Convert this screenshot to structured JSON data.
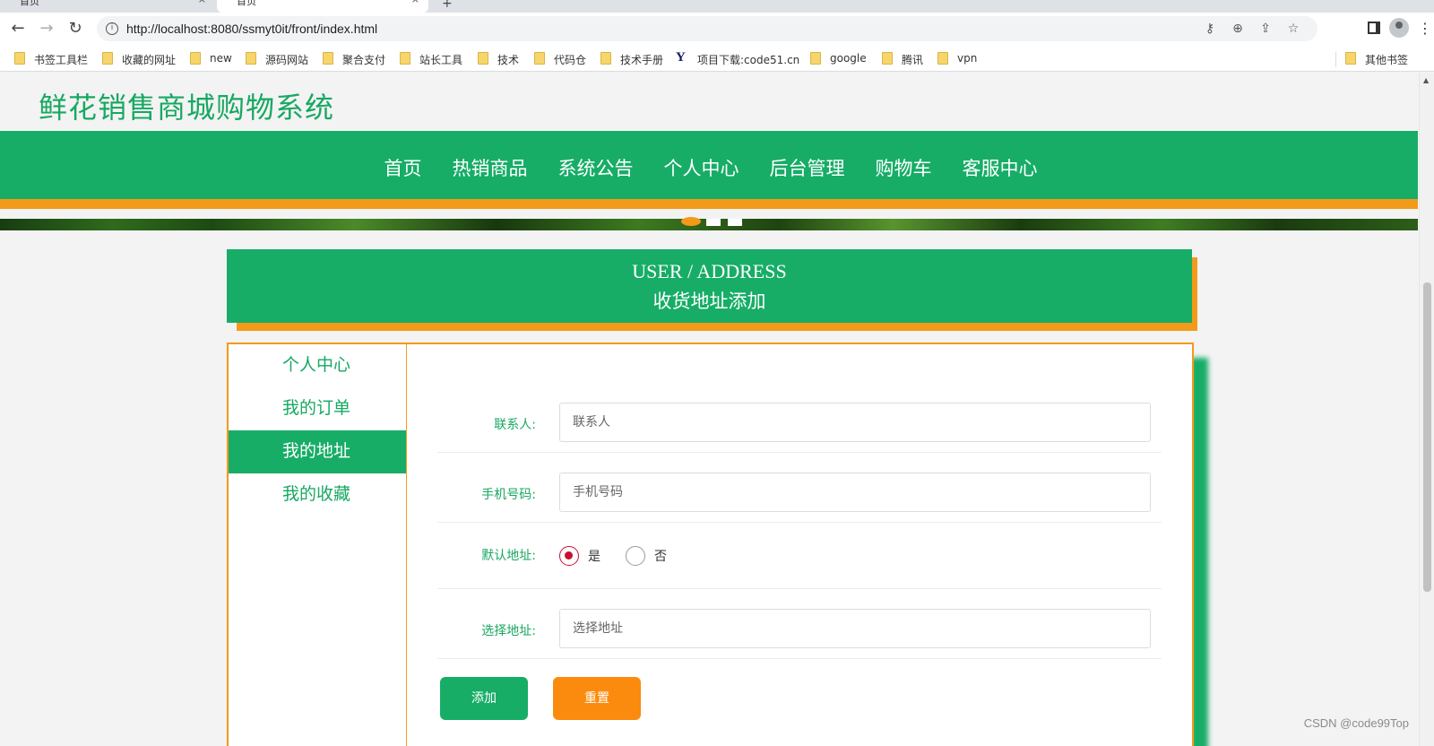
{
  "browser": {
    "tabs": [
      {
        "title": "首页"
      },
      {
        "title": "首页"
      }
    ],
    "new_tab": "+",
    "url": "http://localhost:8080/ssmyt0it/front/index.html",
    "bookmarks": [
      {
        "label": "书签工具栏",
        "icon": "folder-icon"
      },
      {
        "label": "收藏的网址",
        "icon": "folder-icon"
      },
      {
        "label": "new",
        "icon": "folder-icon"
      },
      {
        "label": "源码网站",
        "icon": "folder-icon"
      },
      {
        "label": "聚合支付",
        "icon": "folder-icon"
      },
      {
        "label": "站长工具",
        "icon": "folder-icon"
      },
      {
        "label": "技术",
        "icon": "folder-icon"
      },
      {
        "label": "代码仓",
        "icon": "folder-icon"
      },
      {
        "label": "技术手册",
        "icon": "folder-icon"
      },
      {
        "label": "项目下载:code51.cn",
        "icon": "y-logo-icon"
      },
      {
        "label": "google",
        "icon": "folder-icon"
      },
      {
        "label": "腾讯",
        "icon": "folder-icon"
      },
      {
        "label": "vpn",
        "icon": "folder-icon"
      },
      {
        "label": "其他书签",
        "icon": "folder-icon"
      }
    ]
  },
  "site": {
    "title": "鲜花销售商城购物系统",
    "nav": [
      "首页",
      "热销商品",
      "系统公告",
      "个人中心",
      "后台管理",
      "购物车",
      "客服中心"
    ],
    "brand_color": "#17ad67",
    "accent_color": "#f39a1a"
  },
  "page_header": {
    "en": "USER / ADDRESS",
    "cn": "收货地址添加"
  },
  "side_menu": [
    {
      "label": "个人中心",
      "active": false
    },
    {
      "label": "我的订单",
      "active": false
    },
    {
      "label": "我的地址",
      "active": true
    },
    {
      "label": "我的收藏",
      "active": false
    }
  ],
  "form": {
    "contact": {
      "label": "联系人:",
      "placeholder": "联系人"
    },
    "phone": {
      "label": "手机号码:",
      "placeholder": "手机号码"
    },
    "default": {
      "label": "默认地址:",
      "options": [
        "是",
        "否"
      ],
      "selected": "是"
    },
    "address": {
      "label": "选择地址:",
      "placeholder": "选择地址"
    },
    "add_button": "添加",
    "reset_button": "重置"
  },
  "watermark": "CSDN @code99Top"
}
